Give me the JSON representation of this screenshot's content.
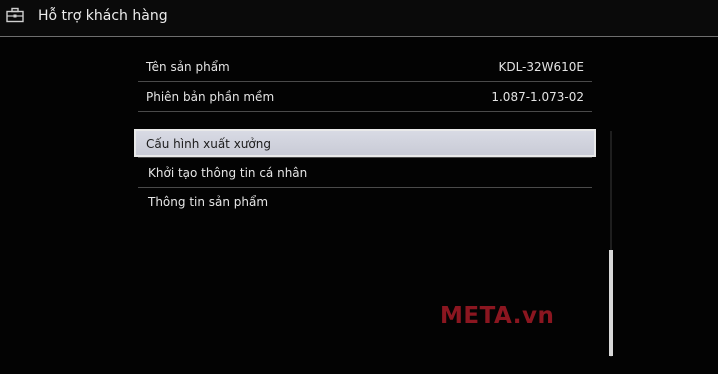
{
  "header": {
    "title": "Hỗ trợ khách hàng",
    "icon": "toolbox-icon"
  },
  "info": [
    {
      "label": "Tên sản phẩm",
      "value": "KDL-32W610E"
    },
    {
      "label": "Phiên bản phần mềm",
      "value": "1.087-1.073-02"
    }
  ],
  "menu": {
    "items": [
      {
        "label": "Cấu hình xuất xưởng",
        "selected": true
      },
      {
        "label": "Khởi tạo thông tin cá nhân",
        "selected": false
      },
      {
        "label": "Thông tin sản phẩm",
        "selected": false
      }
    ]
  },
  "watermark": "META.vn",
  "colors": {
    "background": "#030303",
    "selection": "#d4d6e0",
    "watermark": "#8b1620"
  }
}
